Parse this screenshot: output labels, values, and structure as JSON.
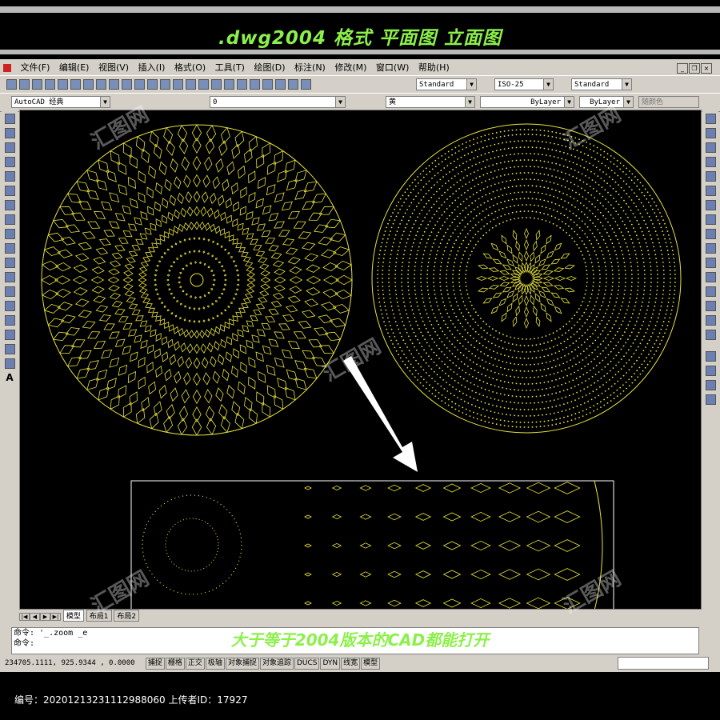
{
  "banner": {
    "title": ".dwg2004 格式  平面图 立面图"
  },
  "menu": [
    "文件(F)",
    "编辑(E)",
    "视图(V)",
    "插入(I)",
    "格式(O)",
    "工具(T)",
    "绘图(D)",
    "标注(N)",
    "修改(M)",
    "窗口(W)",
    "帮助(H)"
  ],
  "toolbar": {
    "text_style": "Standard",
    "dim_style": "ISO-25",
    "table_style": "Standard",
    "workspace": "AutoCAD 经典",
    "layer": "0",
    "color": "黄",
    "linetype": "ByLayer",
    "lineweight": "ByLayer",
    "plot_style": "随颜色"
  },
  "tabs": [
    "模型",
    "布局1",
    "布局2"
  ],
  "command": {
    "line1": "命令: '_.zoom _e",
    "line2": "命令:"
  },
  "caption": "大于等于2004版本的CAD都能打开",
  "status": {
    "coords": "234705.1111, 925.9344 , 0.0000",
    "buttons": [
      "捕捉",
      "栅格",
      "正交",
      "极轴",
      "对象捕捉",
      "对象追踪",
      "DUCS",
      "DYN",
      "线宽",
      "模型"
    ]
  },
  "footer": "编号：20201213231112988060 上传者ID：17927",
  "watermark_text": "汇图网",
  "colors": {
    "drawing": "#e8e23a",
    "caption": "#8cf04a",
    "ui": "#d4d0c8",
    "canvas": "#000000"
  }
}
